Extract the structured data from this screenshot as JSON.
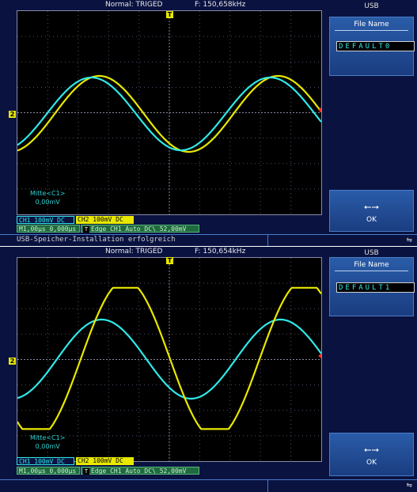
{
  "screens": [
    {
      "status": {
        "mode": "Normal: TRIGED",
        "frequency": "F: 150,658kHz"
      },
      "trigger_marker": "T",
      "ch2_marker": "2",
      "mitte": {
        "label": "Mitte<C1>",
        "value": "0,00mV"
      },
      "ch1_label": "CH1  100mV  DC",
      "ch2_label": "CH2  100mV  DC",
      "timebase": "M1,00µs 0,000µs",
      "trigger": "Edge  CH1  Auto  DC\\  52,00mV",
      "usb_title": "USB",
      "file_name_label": "File Name",
      "file_name_value": "DEFAULT0",
      "ok_label": "OK",
      "usb_icon": "usb-icon",
      "message": "USB-Speicher-Installation erfolgreich"
    },
    {
      "status": {
        "mode": "Normal: TRIGED",
        "frequency": "F: 150,654kHz"
      },
      "trigger_marker": "T",
      "ch2_marker": "2",
      "mitte": {
        "label": "Mitte<C1>",
        "value": "0,00mV"
      },
      "ch1_label": "CH1  100mV  DC",
      "ch2_label": "CH2  100mV  DC",
      "timebase": "M1,00µs 0,000µs",
      "trigger": "Edge  CH1  Auto  DC\\  52,00mV",
      "usb_title": "USB",
      "file_name_label": "File Name",
      "file_name_value": "DEFAULT1",
      "ok_label": "OK",
      "usb_icon": "usb-icon",
      "message": ""
    }
  ],
  "colors": {
    "ch1": "#2fe8e8",
    "ch2": "#e8e800",
    "background": "#0a1240",
    "panel": "#2a5ca8"
  }
}
